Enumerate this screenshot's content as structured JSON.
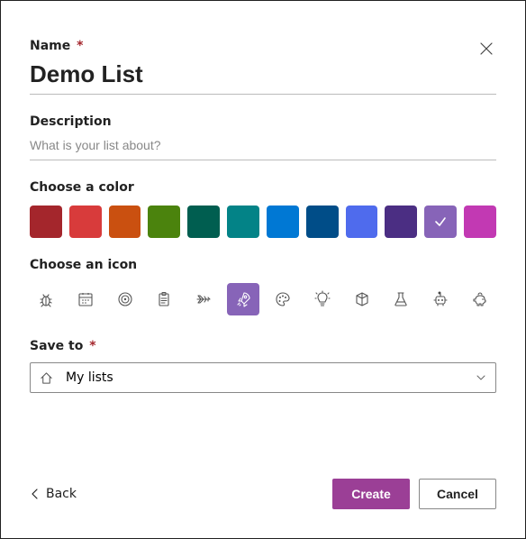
{
  "name": {
    "label": "Name",
    "required_mark": "*",
    "value": "Demo List"
  },
  "description": {
    "label": "Description",
    "placeholder": "What is your list about?",
    "value": ""
  },
  "color_section": {
    "label": "Choose a color",
    "selected_index": 10,
    "swatches": [
      "#a4262c",
      "#d83b3b",
      "#ca5010",
      "#4b830d",
      "#005e50",
      "#038387",
      "#0078d4",
      "#004d88",
      "#4f6bed",
      "#4b2e83",
      "#8764b8",
      "#c239b3"
    ]
  },
  "icon_section": {
    "label": "Choose an icon",
    "selected_index": 5,
    "icons": [
      "bug-icon",
      "calendar-icon",
      "target-icon",
      "clipboard-icon",
      "airplane-icon",
      "rocket-icon",
      "palette-icon",
      "lightbulb-icon",
      "cube-icon",
      "beaker-icon",
      "robot-icon",
      "piggybank-icon"
    ]
  },
  "save_to": {
    "label": "Save to",
    "required_mark": "*",
    "selected": "My lists"
  },
  "footer": {
    "back_label": "Back",
    "create_label": "Create",
    "cancel_label": "Cancel",
    "primary_color": "#9b3f96"
  }
}
